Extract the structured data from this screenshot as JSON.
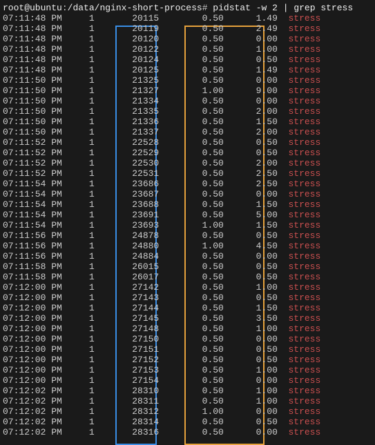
{
  "prompt": {
    "userhost": "root@ubuntu",
    "path": "/data/nginx-short-process",
    "command": "pidstat -w 2 | grep stress"
  },
  "rows": [
    {
      "t": "07:11:48 PM",
      "u": "1",
      "pid": "20115",
      "v1": "0.50",
      "v2": "1.49",
      "cmd": "stress"
    },
    {
      "t": "07:11:48 PM",
      "u": "1",
      "pid": "20119",
      "v1": "0.50",
      "v2": "2.49",
      "cmd": "stress"
    },
    {
      "t": "07:11:48 PM",
      "u": "1",
      "pid": "20120",
      "v1": "0.50",
      "v2": "0.00",
      "cmd": "stress"
    },
    {
      "t": "07:11:48 PM",
      "u": "1",
      "pid": "20122",
      "v1": "0.50",
      "v2": "1.00",
      "cmd": "stress"
    },
    {
      "t": "07:11:48 PM",
      "u": "1",
      "pid": "20124",
      "v1": "0.50",
      "v2": "0.50",
      "cmd": "stress"
    },
    {
      "t": "07:11:48 PM",
      "u": "1",
      "pid": "20125",
      "v1": "0.50",
      "v2": "1.49",
      "cmd": "stress"
    },
    {
      "t": "07:11:50 PM",
      "u": "1",
      "pid": "21325",
      "v1": "0.50",
      "v2": "0.00",
      "cmd": "stress"
    },
    {
      "t": "07:11:50 PM",
      "u": "1",
      "pid": "21327",
      "v1": "1.00",
      "v2": "9.00",
      "cmd": "stress"
    },
    {
      "t": "07:11:50 PM",
      "u": "1",
      "pid": "21334",
      "v1": "0.50",
      "v2": "0.00",
      "cmd": "stress"
    },
    {
      "t": "07:11:50 PM",
      "u": "1",
      "pid": "21335",
      "v1": "0.50",
      "v2": "2.00",
      "cmd": "stress"
    },
    {
      "t": "07:11:50 PM",
      "u": "1",
      "pid": "21336",
      "v1": "0.50",
      "v2": "1.50",
      "cmd": "stress"
    },
    {
      "t": "07:11:50 PM",
      "u": "1",
      "pid": "21337",
      "v1": "0.50",
      "v2": "2.00",
      "cmd": "stress"
    },
    {
      "t": "07:11:52 PM",
      "u": "1",
      "pid": "22528",
      "v1": "0.50",
      "v2": "0.50",
      "cmd": "stress"
    },
    {
      "t": "07:11:52 PM",
      "u": "1",
      "pid": "22529",
      "v1": "0.50",
      "v2": "0.50",
      "cmd": "stress"
    },
    {
      "t": "07:11:52 PM",
      "u": "1",
      "pid": "22530",
      "v1": "0.50",
      "v2": "2.00",
      "cmd": "stress"
    },
    {
      "t": "07:11:52 PM",
      "u": "1",
      "pid": "22531",
      "v1": "0.50",
      "v2": "2.50",
      "cmd": "stress"
    },
    {
      "t": "07:11:54 PM",
      "u": "1",
      "pid": "23686",
      "v1": "0.50",
      "v2": "2.50",
      "cmd": "stress"
    },
    {
      "t": "07:11:54 PM",
      "u": "1",
      "pid": "23687",
      "v1": "0.50",
      "v2": "0.00",
      "cmd": "stress"
    },
    {
      "t": "07:11:54 PM",
      "u": "1",
      "pid": "23688",
      "v1": "0.50",
      "v2": "1.50",
      "cmd": "stress"
    },
    {
      "t": "07:11:54 PM",
      "u": "1",
      "pid": "23691",
      "v1": "0.50",
      "v2": "5.00",
      "cmd": "stress"
    },
    {
      "t": "07:11:54 PM",
      "u": "1",
      "pid": "23693",
      "v1": "1.00",
      "v2": "1.50",
      "cmd": "stress"
    },
    {
      "t": "07:11:56 PM",
      "u": "1",
      "pid": "24878",
      "v1": "0.50",
      "v2": "0.50",
      "cmd": "stress"
    },
    {
      "t": "07:11:56 PM",
      "u": "1",
      "pid": "24880",
      "v1": "1.00",
      "v2": "4.50",
      "cmd": "stress"
    },
    {
      "t": "07:11:56 PM",
      "u": "1",
      "pid": "24884",
      "v1": "0.50",
      "v2": "0.00",
      "cmd": "stress"
    },
    {
      "t": "07:11:58 PM",
      "u": "1",
      "pid": "26015",
      "v1": "0.50",
      "v2": "0.50",
      "cmd": "stress"
    },
    {
      "t": "07:11:58 PM",
      "u": "1",
      "pid": "26017",
      "v1": "0.50",
      "v2": "0.50",
      "cmd": "stress"
    },
    {
      "t": "07:12:00 PM",
      "u": "1",
      "pid": "27142",
      "v1": "0.50",
      "v2": "1.00",
      "cmd": "stress"
    },
    {
      "t": "07:12:00 PM",
      "u": "1",
      "pid": "27143",
      "v1": "0.50",
      "v2": "0.50",
      "cmd": "stress"
    },
    {
      "t": "07:12:00 PM",
      "u": "1",
      "pid": "27144",
      "v1": "0.50",
      "v2": "1.50",
      "cmd": "stress"
    },
    {
      "t": "07:12:00 PM",
      "u": "1",
      "pid": "27145",
      "v1": "0.50",
      "v2": "3.50",
      "cmd": "stress"
    },
    {
      "t": "07:12:00 PM",
      "u": "1",
      "pid": "27148",
      "v1": "0.50",
      "v2": "1.00",
      "cmd": "stress"
    },
    {
      "t": "07:12:00 PM",
      "u": "1",
      "pid": "27150",
      "v1": "0.50",
      "v2": "0.00",
      "cmd": "stress"
    },
    {
      "t": "07:12:00 PM",
      "u": "1",
      "pid": "27151",
      "v1": "0.50",
      "v2": "0.50",
      "cmd": "stress"
    },
    {
      "t": "07:12:00 PM",
      "u": "1",
      "pid": "27152",
      "v1": "0.50",
      "v2": "0.50",
      "cmd": "stress"
    },
    {
      "t": "07:12:00 PM",
      "u": "1",
      "pid": "27153",
      "v1": "0.50",
      "v2": "1.00",
      "cmd": "stress"
    },
    {
      "t": "07:12:00 PM",
      "u": "1",
      "pid": "27154",
      "v1": "0.50",
      "v2": "0.00",
      "cmd": "stress"
    },
    {
      "t": "07:12:02 PM",
      "u": "1",
      "pid": "28310",
      "v1": "0.50",
      "v2": "1.00",
      "cmd": "stress"
    },
    {
      "t": "07:12:02 PM",
      "u": "1",
      "pid": "28311",
      "v1": "0.50",
      "v2": "1.00",
      "cmd": "stress"
    },
    {
      "t": "07:12:02 PM",
      "u": "1",
      "pid": "28312",
      "v1": "1.00",
      "v2": "0.00",
      "cmd": "stress"
    },
    {
      "t": "07:12:02 PM",
      "u": "1",
      "pid": "28314",
      "v1": "0.50",
      "v2": "0.50",
      "cmd": "stress"
    },
    {
      "t": "07:12:02 PM",
      "u": "1",
      "pid": "28316",
      "v1": "0.50",
      "v2": "0.00",
      "cmd": "stress"
    }
  ]
}
